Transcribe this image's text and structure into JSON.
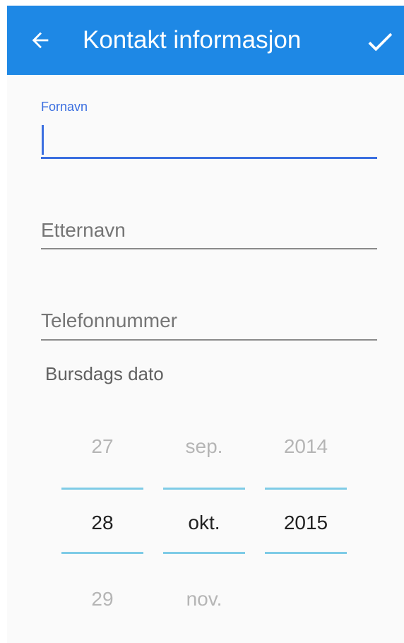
{
  "appbar": {
    "title": "Kontakt informasjon",
    "back_icon": "arrow-left-icon",
    "done_icon": "check-icon"
  },
  "form": {
    "first_name": {
      "label": "Fornavn",
      "value": ""
    },
    "last_name": {
      "placeholder": "Etternavn",
      "value": ""
    },
    "phone": {
      "placeholder": "Telefonnummer",
      "value": ""
    }
  },
  "birthday": {
    "label": "Bursdags dato",
    "day": {
      "prev": "27",
      "current": "28",
      "next": "29"
    },
    "month": {
      "prev": "sep.",
      "current": "okt.",
      "next": "nov."
    },
    "year": {
      "prev": "2014",
      "current": "2015",
      "next": ""
    }
  },
  "colors": {
    "appbar": "#1e88e5",
    "accent": "#3b6fe0",
    "picker_divider": "#7ecbe6",
    "background": "#fafafa"
  }
}
